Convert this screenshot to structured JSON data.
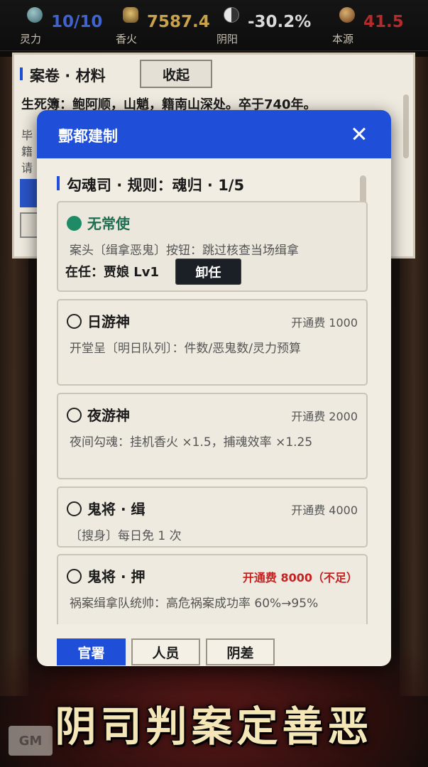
{
  "stats": [
    {
      "label": "灵力",
      "value": "10/10",
      "color": "#3f63d0",
      "icon": "spirit-orb-icon"
    },
    {
      "label": "香火",
      "value": "7587.4",
      "color": "#c9a24a",
      "icon": "incense-icon"
    },
    {
      "label": "阴阳",
      "value": "-30.2%",
      "color": "#d9d9d9",
      "icon": "yin-yang-icon"
    },
    {
      "label": "本源",
      "value": "41.5",
      "color": "#b52a2a",
      "icon": "origin-orb-icon"
    }
  ],
  "case_panel": {
    "title": "案卷 · 材料",
    "collapse_label": "收起",
    "text": "生死簿：鲍阿顺，山魈，籍南山深处。卒于740年。",
    "fragments": [
      "毕",
      "籍",
      "请"
    ]
  },
  "modal": {
    "title": "酆都建制",
    "section": "勾魂司 · 规则：魂归 · 1/5",
    "cards": [
      {
        "name": "无常使",
        "active": true,
        "desc": "案头〔缉拿恶鬼〕按钮：跳过核查当场缉拿",
        "holder": "在任：贾娘 Lv1",
        "dismiss": "卸任"
      },
      {
        "name": "日游神",
        "fee": "开通费 1000",
        "desc": "开堂呈〔明日队列〕：件数/恶鬼数/灵力预算"
      },
      {
        "name": "夜游神",
        "fee": "开通费 2000",
        "desc": "夜间勾魂：挂机香火 ×1.5，捕魂效率 ×1.25"
      },
      {
        "name": "鬼将 · 缉",
        "fee": "开通费 4000",
        "desc": "〔搜身〕每日免 1 次"
      },
      {
        "name": "鬼将 · 押",
        "fee": "开通费 8000（不足）",
        "fee_insufficient": true,
        "desc": "祸案缉拿队统帅：高危祸案成功率 60%→95%"
      }
    ],
    "tabs": [
      {
        "label": "官署",
        "active": true
      },
      {
        "label": "人员",
        "active": false
      },
      {
        "label": "阴差",
        "active": false
      }
    ]
  },
  "banner": "阴司判案定善恶",
  "gm_label": "GM",
  "colors": {
    "accent": "#1f4fd8",
    "active_green": "#1f8a66",
    "warning_red": "#c72222"
  }
}
